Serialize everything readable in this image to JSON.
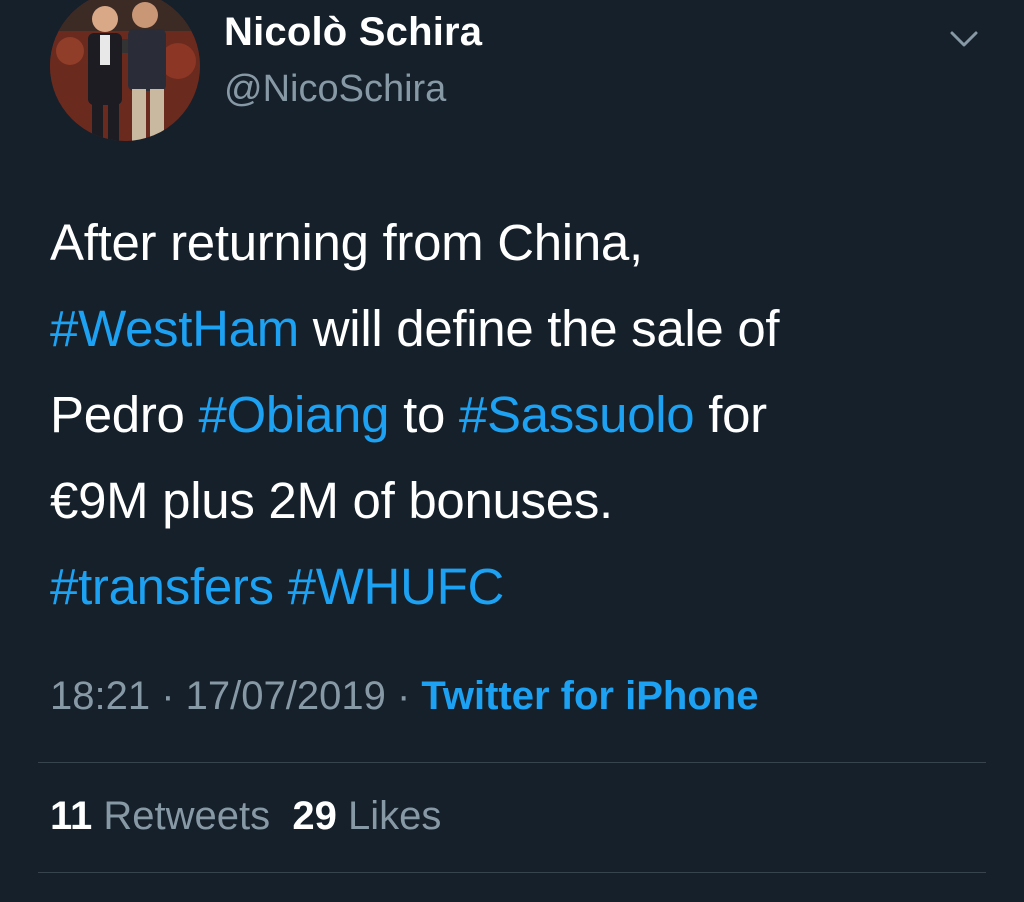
{
  "author": {
    "display_name": "Nicolò Schira",
    "handle": "@NicoSchira"
  },
  "icons": {
    "avatar": "profile-photo",
    "menu": "chevron-down-icon"
  },
  "tweet": {
    "lines": [
      [
        {
          "t": "After returning from China,",
          "tag": false
        }
      ],
      [
        {
          "t": "#WestHam",
          "tag": true
        },
        {
          "t": " will define the sale of",
          "tag": false
        }
      ],
      [
        {
          "t": "Pedro ",
          "tag": false
        },
        {
          "t": "#Obiang",
          "tag": true
        },
        {
          "t": " to ",
          "tag": false
        },
        {
          "t": "#Sassuolo",
          "tag": true
        },
        {
          "t": " for",
          "tag": false
        }
      ],
      [
        {
          "t": "€9M plus 2M of bonuses.",
          "tag": false
        }
      ],
      [
        {
          "t": "#transfers",
          "tag": true
        },
        {
          "t": " ",
          "tag": false
        },
        {
          "t": "#WHUFC",
          "tag": true
        }
      ]
    ]
  },
  "meta": {
    "time": "18:21",
    "separator": " · ",
    "date": "17/07/2019",
    "source": "Twitter for iPhone"
  },
  "stats": {
    "retweets_count": "11",
    "retweets_label": "Retweets",
    "likes_count": "29",
    "likes_label": "Likes"
  },
  "colors": {
    "background": "#15202b",
    "link": "#1da1f2",
    "secondary_text": "#8899a6",
    "divider": "#38444d"
  }
}
